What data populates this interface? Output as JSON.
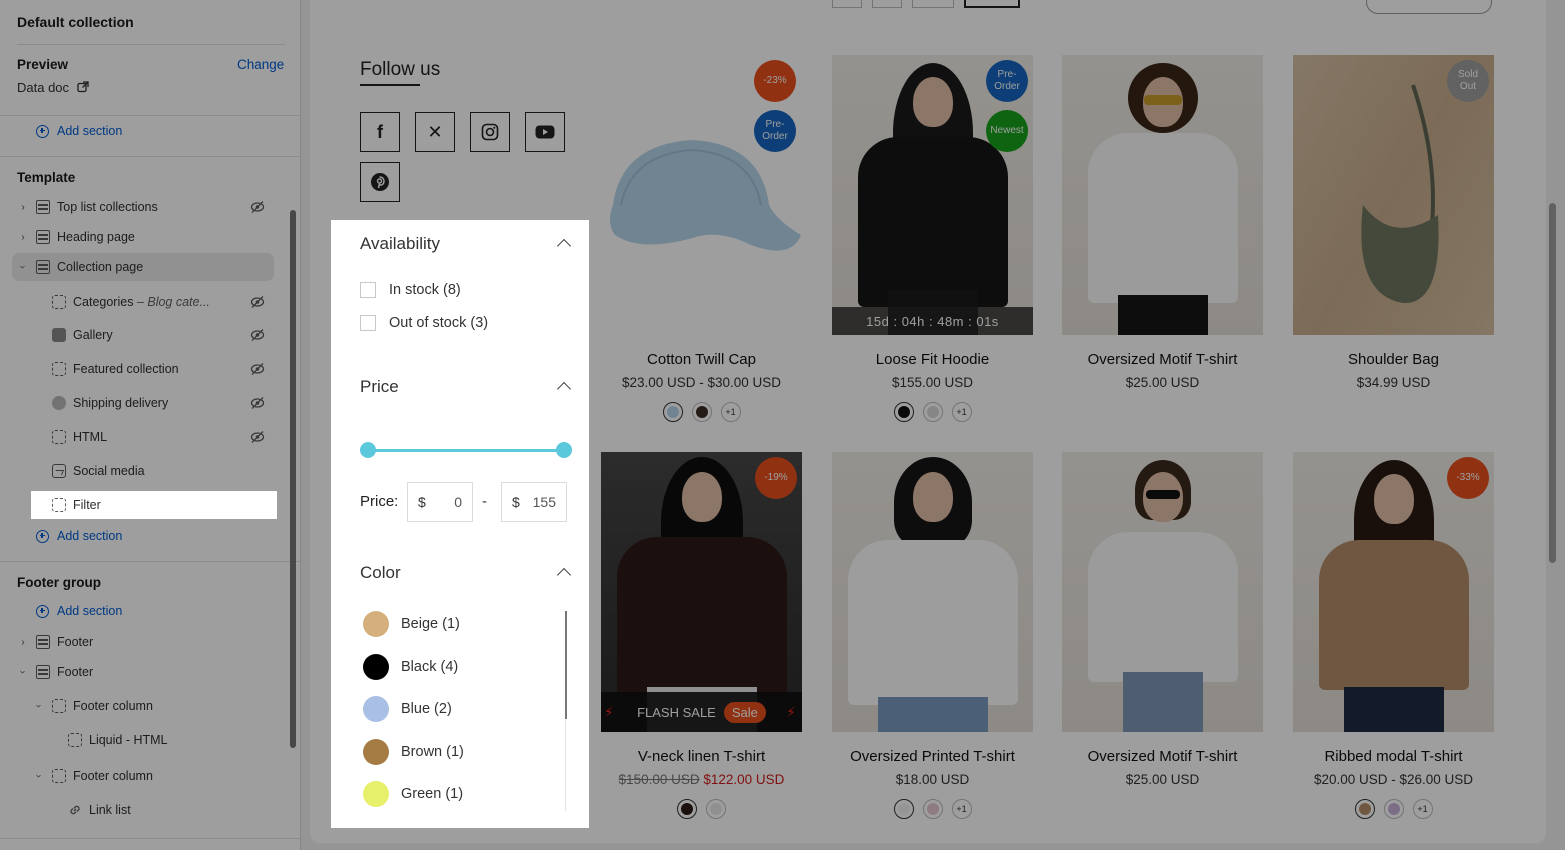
{
  "sidebar": {
    "title": "Default collection",
    "preview_label": "Preview",
    "change_label": "Change",
    "preview_value": "Data doc",
    "add_section": "Add section",
    "template_heading": "Template",
    "template_items": [
      {
        "label": "Top list collections"
      },
      {
        "label": "Heading page"
      },
      {
        "label": "Collection page"
      },
      {
        "label": "Categories",
        "sub": " – Blog cate..."
      },
      {
        "label": "Gallery"
      },
      {
        "label": "Featured collection"
      },
      {
        "label": "Shipping delivery"
      },
      {
        "label": "HTML"
      },
      {
        "label": "Social media"
      },
      {
        "label": "Filter"
      }
    ],
    "footer_heading": "Footer group",
    "footer_items": [
      {
        "label": "Footer"
      },
      {
        "label": "Footer"
      },
      {
        "label": "Footer column"
      },
      {
        "label": "Liquid - HTML"
      },
      {
        "label": "Footer column"
      },
      {
        "label": "Link list"
      }
    ]
  },
  "follow": {
    "title": "Follow us",
    "icons": [
      "facebook-icon",
      "x-icon",
      "instagram-icon",
      "youtube-icon",
      "pinterest-icon"
    ]
  },
  "filter": {
    "availability": {
      "title": "Availability",
      "options": [
        {
          "label": "In stock (8)"
        },
        {
          "label": "Out of stock (3)"
        }
      ]
    },
    "price": {
      "title": "Price",
      "label": "Price:",
      "currency": "$",
      "min": "0",
      "max": "155",
      "dash": "-"
    },
    "color": {
      "title": "Color",
      "options": [
        {
          "label": "Beige (1)",
          "hex": "#d5b07e"
        },
        {
          "label": "Black (4)",
          "hex": "#000000"
        },
        {
          "label": "Blue (2)",
          "hex": "#a9bfe3"
        },
        {
          "label": "Brown (1)",
          "hex": "#a57c44"
        },
        {
          "label": "Green (1)",
          "hex": "#e7f06a"
        }
      ]
    }
  },
  "products": [
    {
      "name": "Cotton Twill Cap",
      "price": "$23.00 USD - $30.00 USD",
      "badges": [
        "-23%",
        "Pre-\nOrder"
      ],
      "more": "+1"
    },
    {
      "name": "Loose Fit Hoodie",
      "price": "$155.00 USD",
      "badges": [
        "Pre-\nOrder",
        "Newest"
      ],
      "timer": "15d : 04h : 48m : 01s",
      "more": "+1"
    },
    {
      "name": "Oversized Motif T-shirt",
      "price": "$25.00 USD"
    },
    {
      "name": "Shoulder Bag",
      "price": "$34.99 USD",
      "badges": [
        "Sold\nOut"
      ]
    },
    {
      "name": "V-neck linen T-shirt",
      "price_old": "$150.00 USD",
      "price_new": "$122.00 USD",
      "badges": [
        "-19%"
      ],
      "flash": "FLASH SALE",
      "sale": "Sale"
    },
    {
      "name": "Oversized Printed T-shirt",
      "price": "$18.00 USD",
      "more": "+1"
    },
    {
      "name": "Oversized Motif T-shirt",
      "price": "$25.00 USD"
    },
    {
      "name": "Ribbed modal T-shirt",
      "price": "$20.00 USD - $26.00 USD",
      "badges": [
        "-33%"
      ],
      "more": "+1"
    }
  ],
  "colors": {
    "link": "#005bd3",
    "badge_discount": "#e8501e",
    "badge_preorder": "#1565c0",
    "badge_newest": "#18a21b",
    "badge_soldout": "#9e9e9e",
    "slider": "#5bc8dc",
    "sale_price": "#d11c1c"
  }
}
